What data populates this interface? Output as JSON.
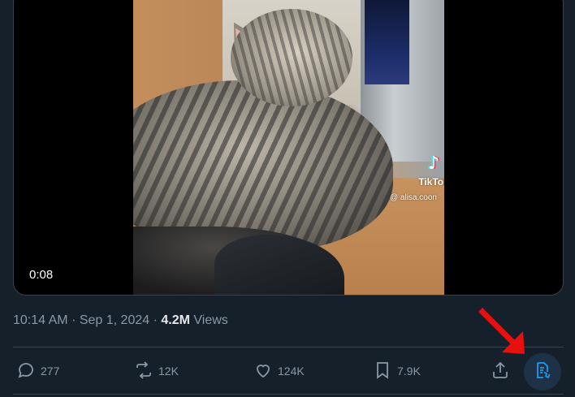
{
  "video": {
    "timer": "0:08",
    "watermark_brand": "TikTok",
    "watermark_user": "@ alisa.coon"
  },
  "tweet_meta": {
    "time": "10:14 AM",
    "separator": "·",
    "date": "Sep 1, 2024",
    "views_count": "4.2M",
    "views_label": "Views"
  },
  "actions": {
    "replies": "277",
    "reposts": "12K",
    "likes": "124K",
    "bookmarks": "7.9K"
  },
  "icons": {
    "reply": "reply-bubble-icon",
    "repost": "repost-arrows-icon",
    "like": "heart-icon",
    "bookmark": "bookmark-icon",
    "share": "share-upload-icon",
    "grok": "grok-document-icon",
    "annotation": "red-arrow-annotation"
  },
  "colors": {
    "background": "#15202b",
    "muted_text": "#8b98a5",
    "highlight_button": "#1e3247",
    "accent_blue": "#1d9bf0",
    "annotation_red": "#e8100f"
  }
}
